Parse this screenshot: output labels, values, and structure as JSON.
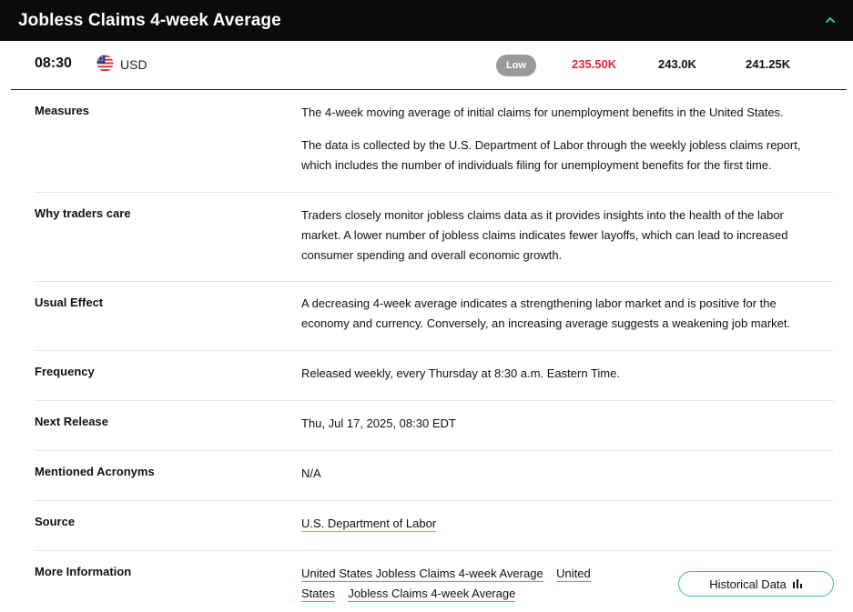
{
  "header": {
    "title": "Jobless Claims 4-week Average",
    "icon": "chevron-up-icon"
  },
  "summary": {
    "time": "08:30",
    "flag_icon": "us-flag-icon",
    "currency": "USD",
    "impact": "Low",
    "actual": "235.50K",
    "forecast": "243.0K",
    "previous": "241.25K",
    "colors": {
      "actual": "#e0253a",
      "impact_badge": "#9a9a9a",
      "accent": "#2fbfae"
    }
  },
  "details": {
    "measures": {
      "label": "Measures",
      "p1": "The 4-week moving average of initial claims for unemployment benefits in the United States.",
      "p2": "The data is collected by the U.S. Department of Labor through the weekly jobless claims report, which includes the number of individuals filing for unemployment benefits for the first time."
    },
    "why": {
      "label": "Why traders care",
      "text": "Traders closely monitor jobless claims data as it provides insights into the health of the labor market. A lower number of jobless claims indicates fewer layoffs, which can lead to increased consumer spending and overall economic growth."
    },
    "effect": {
      "label": "Usual Effect",
      "text": "A decreasing 4-week average indicates a strengthening labor market and is positive for the economy and currency. Conversely, an increasing average suggests a weakening job market."
    },
    "frequency": {
      "label": "Frequency",
      "text": "Released weekly, every Thursday at 8:30 a.m. Eastern Time."
    },
    "next_release": {
      "label": "Next Release",
      "text": "Thu, Jul 17, 2025, 08:30 EDT"
    },
    "acronyms": {
      "label": "Mentioned Acronyms",
      "text": "N/A"
    },
    "source": {
      "label": "Source",
      "link": "U.S. Department of Labor"
    },
    "more_info": {
      "label": "More Information",
      "links": [
        "United States Jobless Claims 4-week Average",
        "United",
        "States",
        "Jobless Claims 4-week Average"
      ],
      "button_label": "Historical Data",
      "button_icon": "bar-chart-icon"
    }
  }
}
